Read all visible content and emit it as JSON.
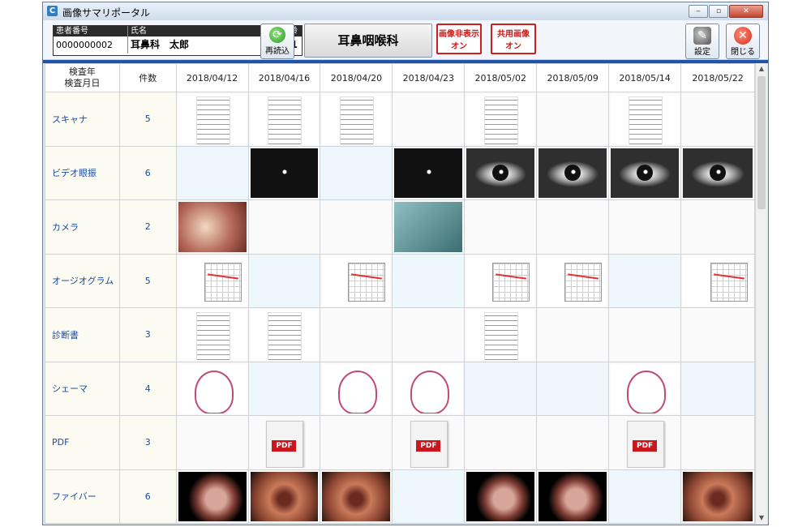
{
  "window": {
    "title": "画像サマリポータル",
    "controls": [
      "minimize",
      "maximize",
      "close"
    ]
  },
  "patient": {
    "id_label": "患者番号",
    "name_label": "氏名",
    "age_label": "年齢",
    "id": "0000000002",
    "name": "耳鼻科　太郎",
    "age": "61"
  },
  "toolbar": {
    "reload_label": "再読込",
    "department": "耳鼻咽喉科",
    "hide_images": {
      "line1": "画像非表示",
      "line2": "オン"
    },
    "shared_images": {
      "line1": "共用画像",
      "line2": "オン"
    },
    "settings_label": "設定",
    "close_label": "閉じる"
  },
  "grid": {
    "corner_line1": "検査年",
    "corner_line2": "検査月日",
    "count_header": "件数",
    "dates": [
      "2018/04/12",
      "2018/04/16",
      "2018/04/20",
      "2018/04/23",
      "2018/05/02",
      "2018/05/09",
      "2018/05/14",
      "2018/05/22"
    ],
    "rows": [
      {
        "label": "スキャナ",
        "count": "5",
        "cells": [
          "doc",
          "doc",
          "doc",
          "",
          "doc",
          "",
          "doc",
          ""
        ]
      },
      {
        "label": "ビデオ眼振",
        "count": "6",
        "cells": [
          "",
          "eye-dark",
          "",
          "eye-dark",
          "eye",
          "eye",
          "eye",
          "eye"
        ]
      },
      {
        "label": "カメラ",
        "count": "2",
        "cells": [
          "surg",
          "",
          "",
          "tool",
          "",
          "",
          "",
          ""
        ]
      },
      {
        "label": "オージオグラム",
        "count": "5",
        "cells": [
          "aud",
          "",
          "aud",
          "",
          "aud",
          "aud",
          "",
          "aud"
        ]
      },
      {
        "label": "診断書",
        "count": "3",
        "cells": [
          "doc",
          "doc",
          "",
          "",
          "doc",
          "",
          "",
          ""
        ]
      },
      {
        "label": "シェーマ",
        "count": "4",
        "cells": [
          "schema",
          "",
          "schema",
          "schema",
          "",
          "",
          "schema",
          ""
        ]
      },
      {
        "label": "PDF",
        "count": "3",
        "cells": [
          "",
          "pdf",
          "",
          "pdf",
          "",
          "",
          "pdf",
          ""
        ]
      },
      {
        "label": "ファイバー",
        "count": "6",
        "cells": [
          "fiber-black",
          "fiber",
          "fiber",
          "",
          "fiber-black",
          "fiber-black",
          "",
          "fiber"
        ]
      }
    ],
    "pdf_tag": "PDF"
  },
  "colors": {
    "accent": "#1f55a8",
    "toggle_red": "#d01515",
    "label_blue": "#1d4a9c",
    "row_label_bg": "#fbfbf2",
    "blank_cell_bg": "#edf7fc"
  }
}
